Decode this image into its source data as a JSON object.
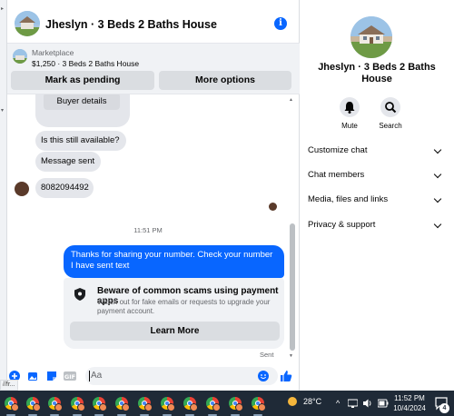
{
  "header": {
    "title": "Jheslyn · 3 Beds 2 Baths House"
  },
  "marketplace": {
    "label": "Marketplace",
    "item": "$1,250 · 3 Beds 2 Baths House",
    "mark_pending_label": "Mark as pending",
    "more_options_label": "More options"
  },
  "messages": {
    "buyer_details_label": "Buyer details",
    "incoming": [
      "Is this still available?",
      "Message sent",
      "8082094492"
    ],
    "timestamp": "11:51 PM",
    "outgoing": "Thanks for sharing your number.  Check your number I have sent text",
    "scam_title": "Beware of common scams using payment apps",
    "scam_desc": "Watch out for fake emails or requests to upgrade your payment account.",
    "learn_more_label": "Learn More",
    "sent_status": "Sent"
  },
  "composer": {
    "placeholder": "Aa"
  },
  "side": {
    "name": "Jheslyn · 3 Beds 2 Baths House",
    "mute_label": "Mute",
    "search_label": "Search",
    "rows": [
      "Customize chat",
      "Chat members",
      "Media, files and links",
      "Privacy & support"
    ]
  },
  "status_url": "//fr...",
  "taskbar": {
    "temperature": "28°C",
    "time": "11:52 PM",
    "date": "10/4/2024",
    "notification_count": "4"
  },
  "colors": {
    "accent": "#0866ff",
    "taskbar": "#1f2a37",
    "bubble_in": "#e4e6eb"
  }
}
